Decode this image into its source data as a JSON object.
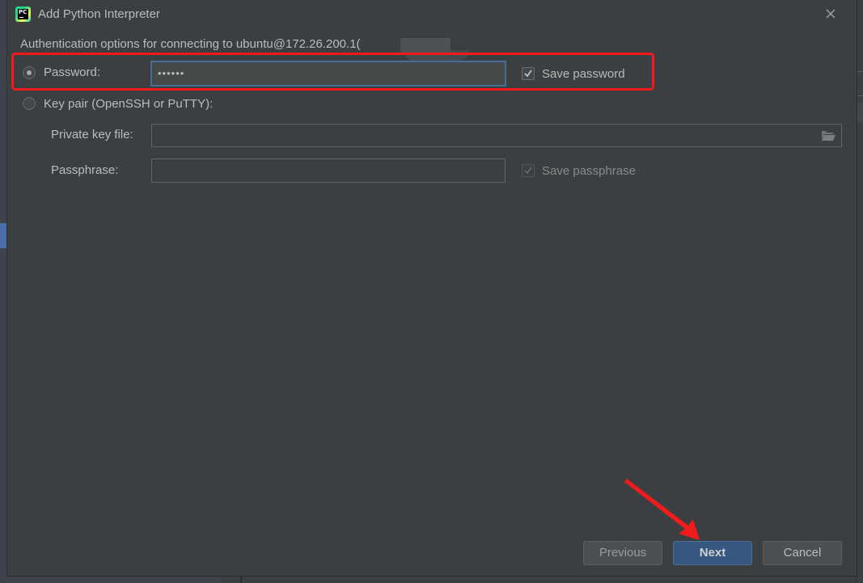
{
  "window": {
    "title": "Add Python Interpreter",
    "app_icon": "pycharm-icon",
    "app_icon_text": "PC",
    "close_icon": "close-icon"
  },
  "auth": {
    "heading": "Authentication options for connecting to ubuntu@172.26.200.1(",
    "password_option": {
      "label": "Password:",
      "selected": true,
      "value_masked": "••••••",
      "save_label": "Save password",
      "save_checked": true
    },
    "keypair_option": {
      "label": "Key pair (OpenSSH or PuTTY):",
      "selected": false,
      "private_key_label": "Private key file:",
      "private_key_value": "",
      "browse_icon": "folder-open-icon",
      "passphrase_label": "Passphrase:",
      "passphrase_value": "",
      "save_passphrase_label": "Save passphrase",
      "save_passphrase_checked": true,
      "save_passphrase_disabled": true
    }
  },
  "buttons": {
    "previous": "Previous",
    "next": "Next",
    "cancel": "Cancel"
  },
  "annotations": {
    "highlight_color": "#f21b1b",
    "arrow_color": "#f21b1b"
  },
  "colors": {
    "dialog_bg": "#3c3f41",
    "primary_button": "#365880",
    "focus_border": "#466d94",
    "text": "#bbbbbb"
  }
}
